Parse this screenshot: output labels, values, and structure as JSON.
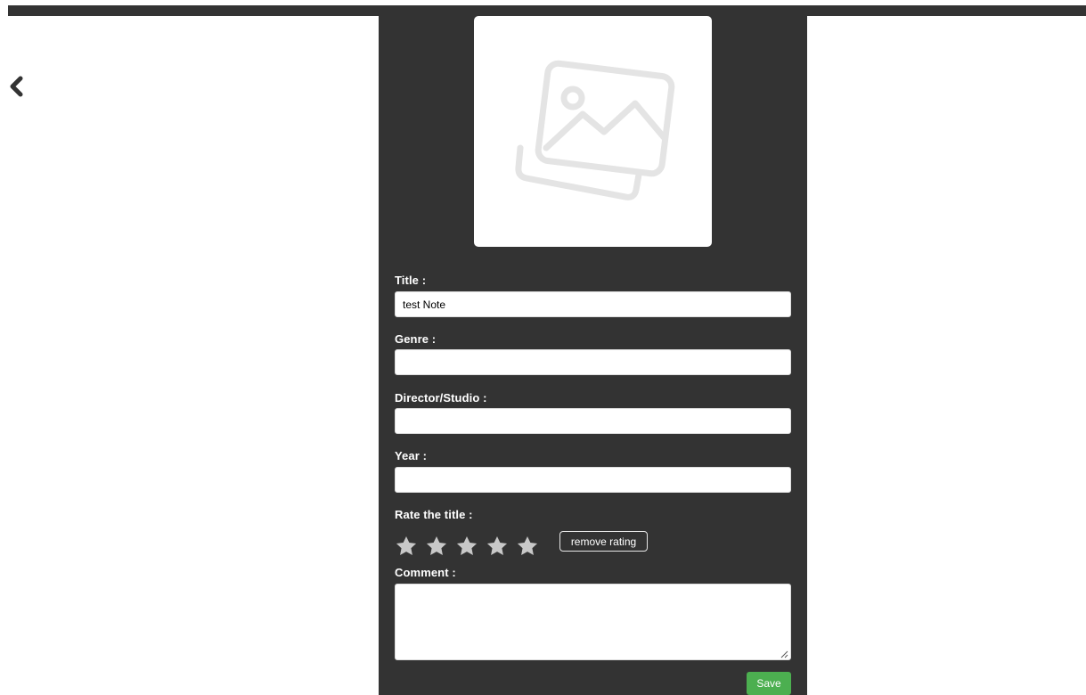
{
  "colors": {
    "panel_background": "#333333",
    "label_text": "#ffffff",
    "save_button": "#4caf50",
    "star_inactive": "#c8c8c8",
    "placeholder_icon": "#e4e4e4"
  },
  "nav": {
    "back_icon": "chevron-left-icon"
  },
  "cover": {
    "icon": "image-placeholder-icon"
  },
  "form": {
    "title_label": "Title :",
    "title_value": "test Note",
    "genre_label": "Genre :",
    "genre_value": "",
    "director_label": "Director/Studio :",
    "director_value": "",
    "year_label": "Year :",
    "year_value": "",
    "rating_label": "Rate the title :",
    "rating_value": 0,
    "rating_max": 5,
    "remove_rating_label": "remove rating",
    "comment_label": "Comment :",
    "comment_value": "",
    "save_label": "Save"
  }
}
